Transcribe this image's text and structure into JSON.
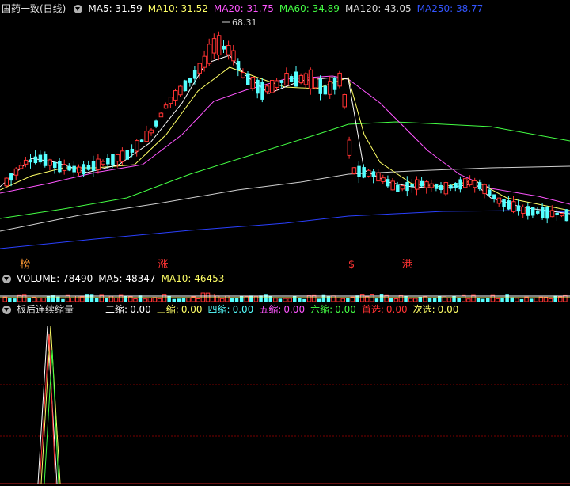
{
  "main": {
    "title": "国药一致(日线)",
    "ma_items": [
      {
        "label": "MA5: 31.59",
        "color": "#ffffff"
      },
      {
        "label": "MA10: 31.52",
        "color": "#ffff66"
      },
      {
        "label": "MA20: 31.75",
        "color": "#ff55ff"
      },
      {
        "label": "MA60: 34.89",
        "color": "#44ff44"
      },
      {
        "label": "MA120: 43.05",
        "color": "#d8d8d8"
      },
      {
        "label": "MA250: 38.77",
        "color": "#3355ff"
      }
    ],
    "peak_label": "68.31",
    "markers": [
      {
        "text": "榜",
        "color": "#ff9933",
        "pos": 0.035
      },
      {
        "text": "涨",
        "color": "#ff3333",
        "pos": 0.277
      },
      {
        "text": "$",
        "color": "#ff3333",
        "pos": 0.611
      },
      {
        "text": "港",
        "color": "#ff3333",
        "pos": 0.705
      }
    ]
  },
  "volume": {
    "label": "VOLUME: 78490",
    "ma5": "MA5: 48347",
    "ma10": "MA10: 46453"
  },
  "indicator": {
    "title": "板后连续缩量",
    "items": [
      {
        "label": "二缩:",
        "value": "0.00",
        "color": "#ffffff"
      },
      {
        "label": "三缩:",
        "value": "0.00",
        "color": "#ffff66"
      },
      {
        "label": "四缩:",
        "value": "0.00",
        "color": "#55ffff"
      },
      {
        "label": "五缩:",
        "value": "0.00",
        "color": "#ff55ff"
      },
      {
        "label": "六缩:",
        "value": "0.00",
        "color": "#44ff44"
      },
      {
        "label": "首选:",
        "value": "0.00",
        "color": "#ff3333"
      },
      {
        "label": "次选:",
        "value": "0.00",
        "color": "#ffff66"
      }
    ]
  },
  "colors": {
    "up": "#ff3333",
    "down": "#55ffff",
    "grid": "#7a0000"
  }
}
